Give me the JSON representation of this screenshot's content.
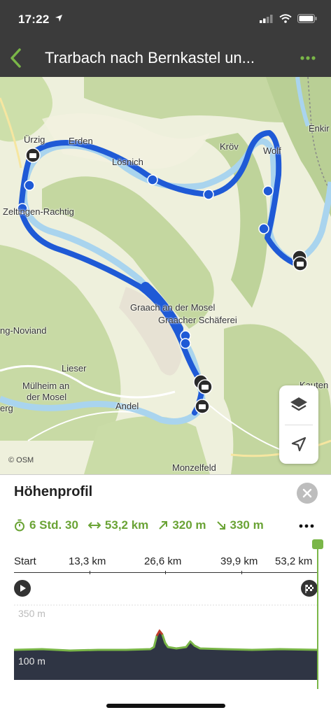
{
  "status_bar": {
    "time": "17:22"
  },
  "nav": {
    "title": "Trarbach nach Bernkastel un..."
  },
  "map": {
    "labels": {
      "uerzig": "Ürzig",
      "erden": "Erden",
      "loesnich": "Lösnich",
      "kroev": "Kröv",
      "wolf": "Wolf",
      "enkirch": "Enkir",
      "zeltingen": "Zeltingen-Rachtig",
      "graach": "Graach an der Mosel",
      "graacher": "Graacher Schäferei",
      "noviand": "ng-Noviand",
      "lieser": "Lieser",
      "muelheim_1": "Mülheim an",
      "muelheim_2": "der Mosel",
      "andel": "Andel",
      "kauten": "Kauten",
      "berg": "erg",
      "monzelfeld": "Monzelfeld"
    },
    "attribution": "© OSM",
    "route_color": "#1f5ad6",
    "river_color": "#a9d4ee"
  },
  "elevation": {
    "title": "Höhenprofil",
    "stats": {
      "duration": "6 Std. 30",
      "distance": "53,2 km",
      "ascent": "320 m",
      "descent": "330 m"
    },
    "axis": [
      "Start",
      "13,3 km",
      "26,6 km",
      "39,9 km",
      "53,2 km"
    ],
    "y_labels": {
      "top": "350 m",
      "bottom": "100 m"
    },
    "accent_color": "#7ab648"
  }
}
